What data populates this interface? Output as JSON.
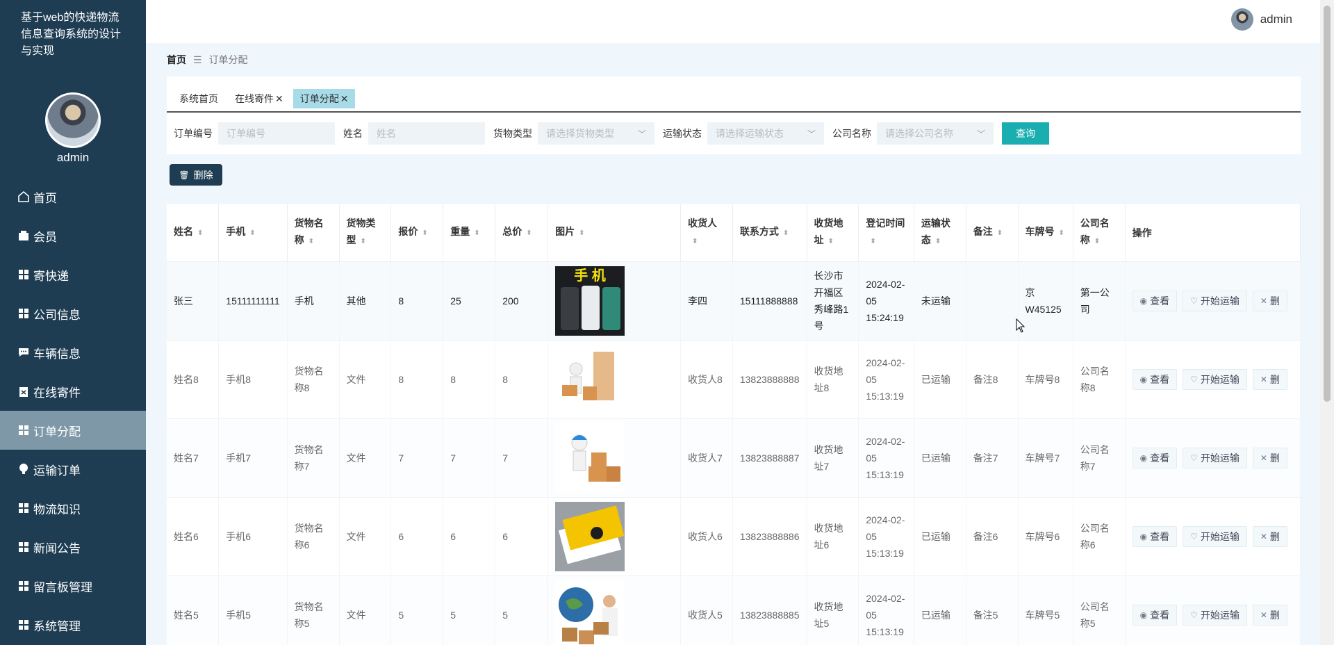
{
  "sidebar": {
    "app_title": "基于web的快递物流信息查询系统的设计与实现",
    "username": "admin",
    "items": [
      {
        "label": "首页",
        "icon": "home-icon"
      },
      {
        "label": "会员",
        "icon": "wallet-icon"
      },
      {
        "label": "寄快递",
        "icon": "grid-icon"
      },
      {
        "label": "公司信息",
        "icon": "grid-icon"
      },
      {
        "label": "车辆信息",
        "icon": "chat-icon"
      },
      {
        "label": "在线寄件",
        "icon": "clipboard-icon"
      },
      {
        "label": "订单分配",
        "icon": "grid-icon"
      },
      {
        "label": "运输订单",
        "icon": "bulb-icon"
      },
      {
        "label": "物流知识",
        "icon": "grid-icon"
      },
      {
        "label": "新闻公告",
        "icon": "grid-icon"
      },
      {
        "label": "留言板管理",
        "icon": "grid-icon"
      },
      {
        "label": "系统管理",
        "icon": "grid-icon"
      }
    ],
    "active_index": 6
  },
  "topbar": {
    "username": "admin"
  },
  "breadcrumb": {
    "home": "首页",
    "separator": "☰",
    "current": "订单分配"
  },
  "tabs": [
    {
      "label": "系统首页",
      "closable": false
    },
    {
      "label": "在线寄件",
      "closable": true
    },
    {
      "label": "订单分配",
      "closable": true,
      "active": true
    }
  ],
  "filters": {
    "order_no_label": "订单编号",
    "order_no_placeholder": "订单编号",
    "name_label": "姓名",
    "name_placeholder": "姓名",
    "goods_type_label": "货物类型",
    "goods_type_placeholder": "请选择货物类型",
    "status_label": "运输状态",
    "status_placeholder": "请选择运输状态",
    "company_label": "公司名称",
    "company_placeholder": "请选择公司名称",
    "query_label": "查询"
  },
  "delete_label": "删除",
  "table": {
    "headers": [
      "姓名",
      "手机",
      "货物名称",
      "货物类型",
      "报价",
      "重量",
      "总价",
      "图片",
      "收货人",
      "联系方式",
      "收货地址",
      "登记时间",
      "运输状态",
      "备注",
      "车牌号",
      "公司名称",
      "操作"
    ],
    "rows": [
      [
        "张三",
        "15111111111",
        "手机",
        "其他",
        "8",
        "25",
        "200",
        "",
        "李四",
        "15111888888",
        "长沙市开福区秀峰路1号",
        "2024-02-05 15:24:19",
        "未运输",
        "",
        "京W45125",
        "第一公司"
      ],
      [
        "姓名8",
        "手机8",
        "货物名称8",
        "文件",
        "8",
        "8",
        "8",
        "",
        "收货人8",
        "13823888888",
        "收货地址8",
        "2024-02-05 15:13:19",
        "已运输",
        "备注8",
        "车牌号8",
        "公司名称8"
      ],
      [
        "姓名7",
        "手机7",
        "货物名称7",
        "文件",
        "7",
        "7",
        "7",
        "",
        "收货人7",
        "13823888887",
        "收货地址7",
        "2024-02-05 15:13:19",
        "已运输",
        "备注7",
        "车牌号7",
        "公司名称7"
      ],
      [
        "姓名6",
        "手机6",
        "货物名称6",
        "文件",
        "6",
        "6",
        "6",
        "",
        "收货人6",
        "13823888886",
        "收货地址6",
        "2024-02-05 15:13:19",
        "已运输",
        "备注6",
        "车牌号6",
        "公司名称6"
      ],
      [
        "姓名5",
        "手机5",
        "货物名称5",
        "文件",
        "5",
        "5",
        "5",
        "",
        "收货人5",
        "13823888885",
        "收货地址5",
        "2024-02-05 15:13:19",
        "已运输",
        "备注5",
        "车牌号5",
        "公司名称5"
      ]
    ],
    "actions": {
      "view": "查看",
      "start": "开始运输",
      "delete": "删"
    },
    "image_text_row1": "手 机"
  },
  "colors": {
    "sidebar": "#1e3c52",
    "sidebar_active": "#7e98a8",
    "accent": "#1aaeb0",
    "tab_active": "#a8dbe8"
  }
}
